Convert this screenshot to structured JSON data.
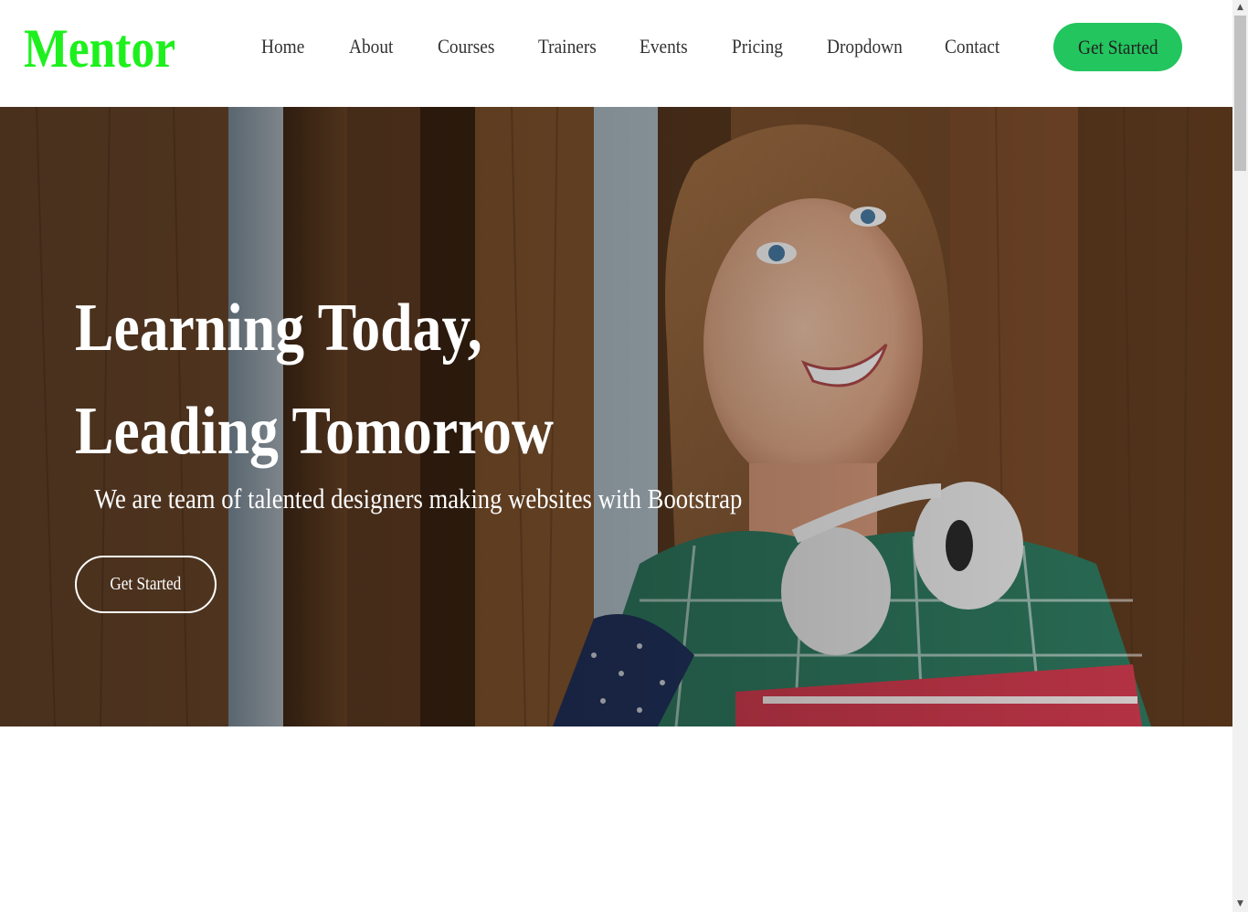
{
  "header": {
    "logo": "Mentor",
    "nav": [
      {
        "label": "Home"
      },
      {
        "label": "About"
      },
      {
        "label": "Courses"
      },
      {
        "label": "Trainers"
      },
      {
        "label": "Events"
      },
      {
        "label": "Pricing"
      },
      {
        "label": "Dropdown"
      },
      {
        "label": "Contact"
      }
    ],
    "cta_label": "Get Started"
  },
  "hero": {
    "title_line1": "Learning Today,",
    "title_line2": "Leading Tomorrow",
    "subtitle": "We are team of talented designers making websites with Bootstrap",
    "cta_label": "Get Started"
  },
  "colors": {
    "logo": "#1ef01e",
    "header_cta_bg": "#22c55e",
    "hero_text": "#ffffff"
  }
}
